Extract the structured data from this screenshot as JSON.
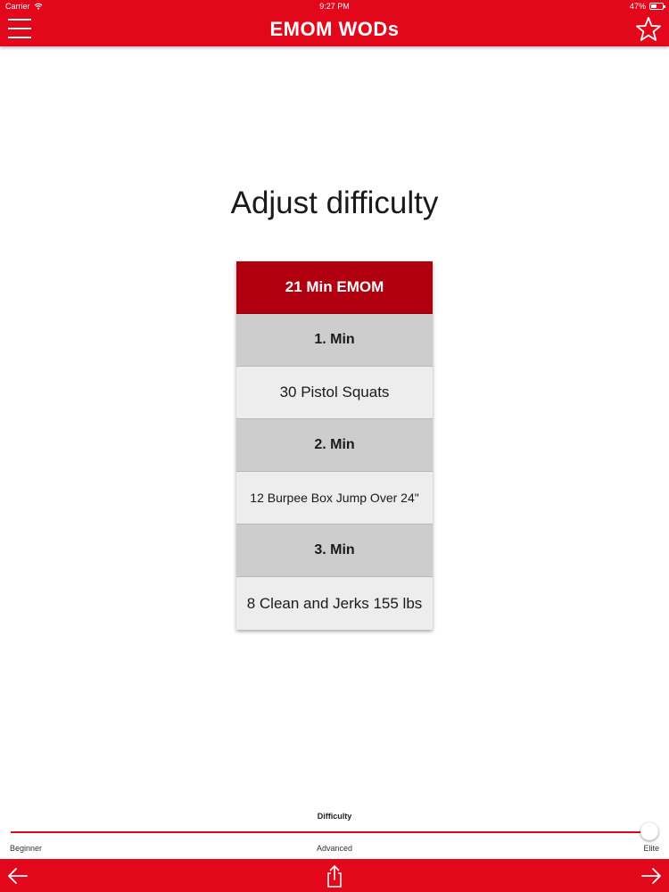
{
  "status_bar": {
    "carrier": "Carrier",
    "time": "9:27 PM",
    "battery": "47%"
  },
  "nav": {
    "title": "EMOM WODs",
    "left_icon": "hamburger-menu-icon",
    "right_icon": "star-outline-icon"
  },
  "main": {
    "heading": "Adjust difficulty",
    "workout": {
      "title": "21 Min EMOM",
      "rows": [
        {
          "type": "minute",
          "text": "1. Min"
        },
        {
          "type": "exercise",
          "text": "30 Pistol Squats"
        },
        {
          "type": "minute",
          "text": "2. Min"
        },
        {
          "type": "exercise",
          "text": "12 Burpee Box Jump Over 24\""
        },
        {
          "type": "minute",
          "text": "3. Min"
        },
        {
          "type": "exercise",
          "text": "8 Clean and Jerks 155 lbs"
        }
      ]
    }
  },
  "difficulty": {
    "label": "Difficulty",
    "levels": [
      "Beginner",
      "Advanced",
      "Elite"
    ],
    "selected": "Elite",
    "value": 1.0
  },
  "toolbar": {
    "back_icon": "arrow-left-icon",
    "share_icon": "share-icon",
    "forward_icon": "arrow-right-icon"
  },
  "colors": {
    "brand_red": "#e3071c",
    "header_red": "#b00010",
    "minute_row": "#cdcdcd",
    "exercise_row": "#ededed"
  }
}
